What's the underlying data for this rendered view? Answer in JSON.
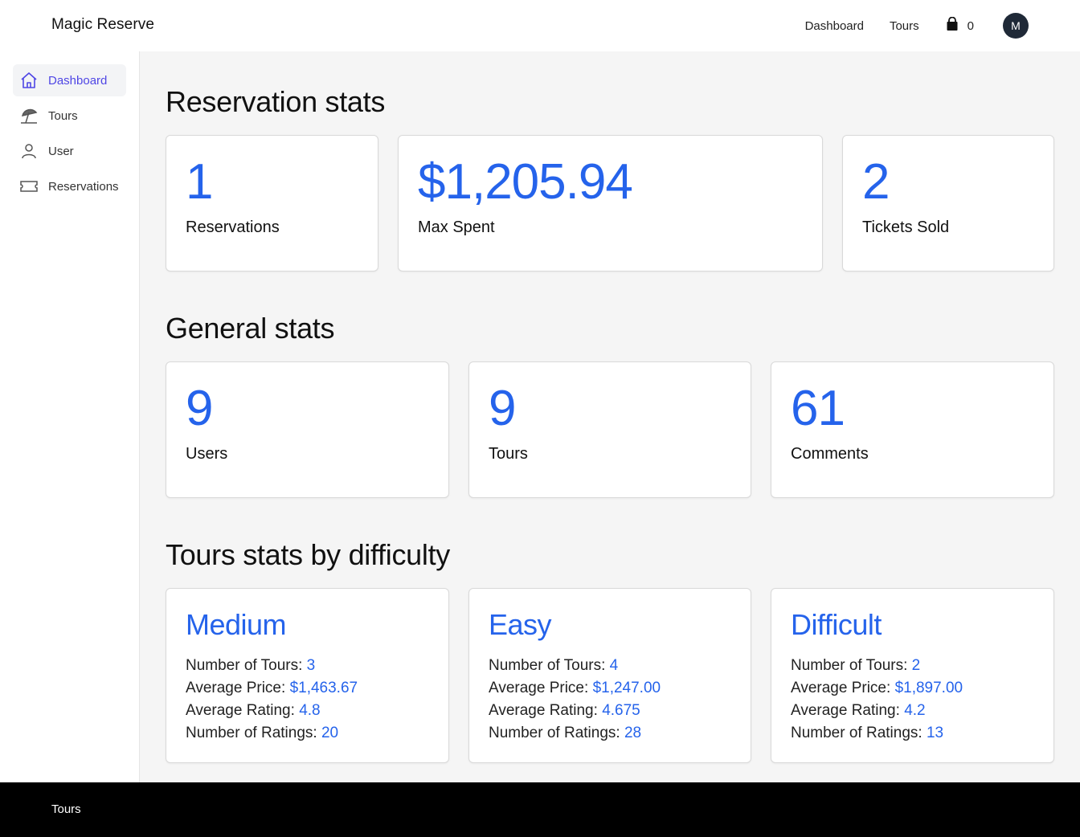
{
  "header": {
    "brand": "Magic Reserve",
    "nav": [
      "Dashboard",
      "Tours"
    ],
    "cart_count": "0",
    "avatar_initial": "M"
  },
  "sidebar": {
    "items": [
      {
        "label": "Dashboard",
        "icon": "home-icon",
        "active": true
      },
      {
        "label": "Tours",
        "icon": "beach-umbrella-icon",
        "active": false
      },
      {
        "label": "User",
        "icon": "user-icon",
        "active": false
      },
      {
        "label": "Reservations",
        "icon": "ticket-icon",
        "active": false
      }
    ]
  },
  "reservation_stats": {
    "title": "Reservation stats",
    "cards": [
      {
        "value": "1",
        "label": "Reservations"
      },
      {
        "value": "$1,205.94",
        "label": "Max Spent"
      },
      {
        "value": "2",
        "label": "Tickets Sold"
      }
    ]
  },
  "general_stats": {
    "title": "General stats",
    "cards": [
      {
        "value": "9",
        "label": "Users"
      },
      {
        "value": "9",
        "label": "Tours"
      },
      {
        "value": "61",
        "label": "Comments"
      }
    ]
  },
  "difficulty_stats": {
    "title": "Tours stats by difficulty",
    "labels": {
      "num_tours": "Number of Tours:",
      "avg_price": "Average Price:",
      "avg_rating": "Average Rating:",
      "num_ratings": "Number of Ratings:"
    },
    "cards": [
      {
        "difficulty": "Medium",
        "num_tours": "3",
        "avg_price": "$1,463.67",
        "avg_rating": "4.8",
        "num_ratings": "20"
      },
      {
        "difficulty": "Easy",
        "num_tours": "4",
        "avg_price": "$1,247.00",
        "avg_rating": "4.675",
        "num_ratings": "28"
      },
      {
        "difficulty": "Difficult",
        "num_tours": "2",
        "avg_price": "$1,897.00",
        "avg_rating": "4.2",
        "num_ratings": "13"
      }
    ]
  },
  "footer": {
    "link": "Tours"
  },
  "colors": {
    "accent": "#2563eb",
    "active_nav": "#4f46e5",
    "footer_bg": "#000000"
  }
}
